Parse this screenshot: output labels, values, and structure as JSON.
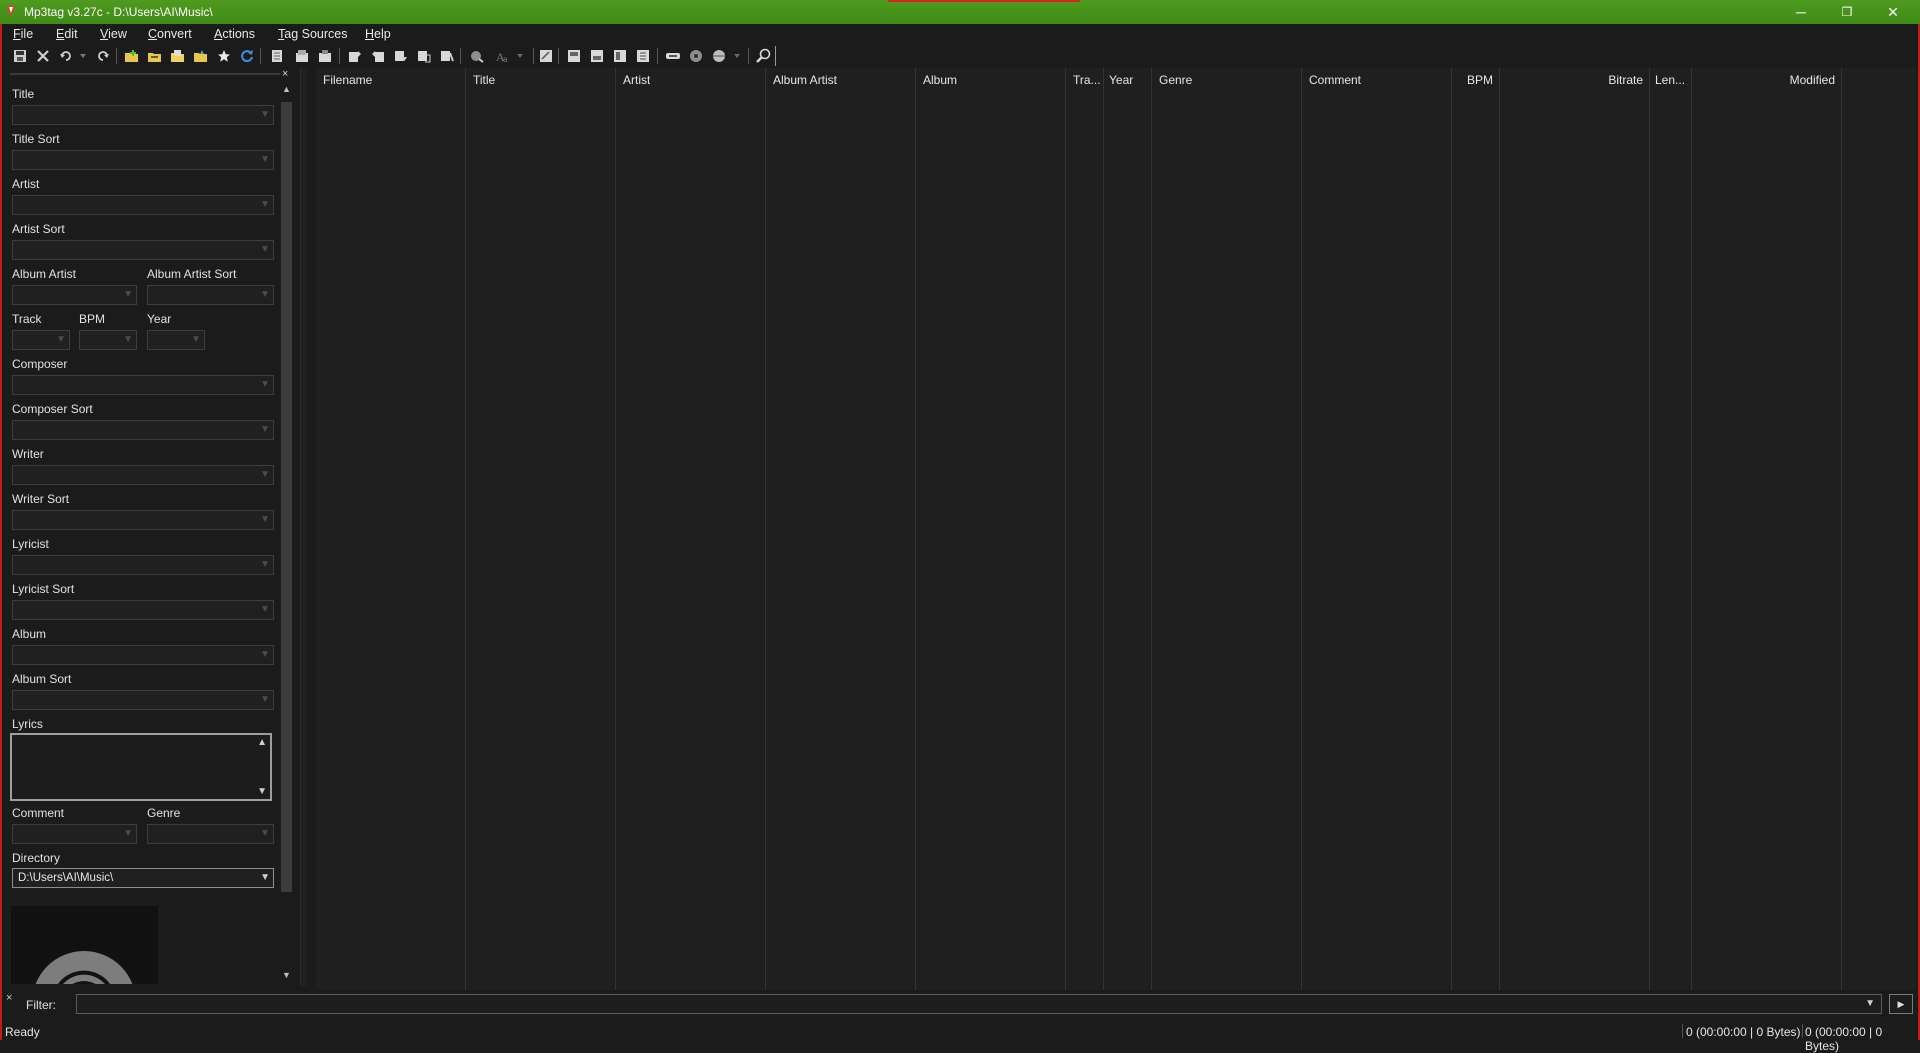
{
  "window": {
    "title": "Mp3tag v3.27c  -  D:\\Users\\AI\\Music\\",
    "minimize_icon": "─",
    "restore_icon": "❐",
    "close_icon": "✕"
  },
  "menu": [
    "File",
    "Edit",
    "View",
    "Convert",
    "Actions",
    "Tag Sources",
    "Help"
  ],
  "menu_underline": [
    "F",
    "E",
    "V",
    "C",
    "A",
    "T",
    "H"
  ],
  "toolbar": {
    "icons": [
      "save-tag",
      "remove-tag",
      "undo",
      "redo",
      "add-directory",
      "change-directory",
      "add-folder",
      "favorites",
      "refresh",
      "select-all",
      "copy-tag",
      "paste-tag",
      "export",
      "tag-to-filename",
      "filename-to-tag",
      "tag-to-tag",
      "text-file-to-tag",
      "autonumbering",
      "case-conversion",
      "extended-tags",
      "playlist",
      "import-cover",
      "export-cover",
      "clear-cover",
      "sort",
      "web-source",
      "discogs",
      "search"
    ]
  },
  "tag_panel": {
    "close": "×",
    "fields": {
      "title": "Title",
      "title_sort": "Title Sort",
      "artist": "Artist",
      "artist_sort": "Artist Sort",
      "album_artist": "Album Artist",
      "album_artist_sort": "Album Artist Sort",
      "track": "Track",
      "bpm": "BPM",
      "year": "Year",
      "composer": "Composer",
      "composer_sort": "Composer Sort",
      "writer": "Writer",
      "writer_sort": "Writer Sort",
      "lyricist": "Lyricist",
      "lyricist_sort": "Lyricist Sort",
      "album": "Album",
      "album_sort": "Album Sort",
      "lyrics": "Lyrics",
      "comment": "Comment",
      "genre": "Genre",
      "directory": "Directory"
    },
    "directory_value": "D:\\Users\\AI\\Music\\"
  },
  "file_list": {
    "columns": [
      "Filename",
      "Title",
      "Artist",
      "Album Artist",
      "Album",
      "Tra...",
      "Year",
      "Genre",
      "Comment",
      "BPM",
      "Bitrate",
      "Len...",
      "Modified"
    ]
  },
  "filter": {
    "label": "Filter:",
    "value": "",
    "close": "×"
  },
  "status": {
    "text": "Ready",
    "selected": "0 (00:00:00 | 0 Bytes)",
    "total": "0 (00:00:00 | 0 Bytes)"
  },
  "colors": {
    "titlebar": "#4f9a1f",
    "border": "#c31c12",
    "background": "#1b1b1b",
    "list_background": "#1f1f1f"
  }
}
